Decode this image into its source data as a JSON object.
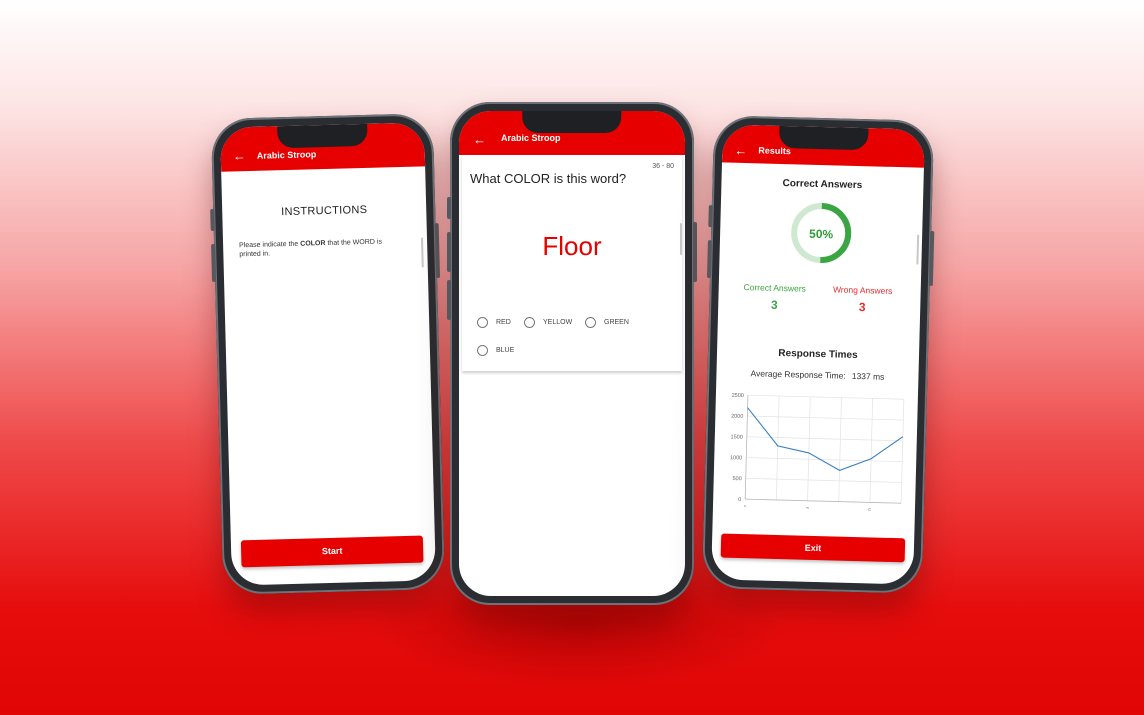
{
  "screens": {
    "instructions": {
      "title": "Arabic Stroop",
      "heading": "INSTRUCTIONS",
      "text_before": "Please indicate the ",
      "text_bold1": "COLOR",
      "text_mid": " that the ",
      "text_bold2": "WORD",
      "text_after": " is printed in.",
      "start_label": "Start"
    },
    "question": {
      "title": "Arabic Stroop",
      "counter": "36 - 80",
      "prompt": "What COLOR is this word?",
      "word": "Floor",
      "options": [
        "RED",
        "YELLOW",
        "GREEN",
        "BLUE"
      ]
    },
    "results": {
      "title": "Results",
      "correct_heading": "Correct Answers",
      "percent": "50%",
      "percent_value": 0.5,
      "correct_label": "Correct Answers",
      "correct_value": "3",
      "wrong_label": "Wrong Answers",
      "wrong_value": "3",
      "response_heading": "Response Times",
      "avg_label": "Average Response Time:",
      "avg_value": "1337 ms",
      "exit_label": "Exit"
    }
  },
  "colors": {
    "brand_red": "#e60000",
    "correct_green": "#3aa543",
    "wrong_red": "#ec2a2a",
    "line_blue": "#3a7fc2"
  },
  "chart_data": {
    "type": "line",
    "x": [
      1,
      2,
      3,
      4,
      5,
      6
    ],
    "y_ticks": [
      "2500",
      "2000",
      "1500",
      "1000",
      "500",
      "0"
    ],
    "x_ticks": [
      "1",
      "3",
      "5"
    ],
    "series": [
      {
        "values": [
          2200,
          1300,
          1150,
          750,
          1050,
          1600
        ]
      }
    ],
    "ylim": [
      0,
      2500
    ],
    "xlim": [
      1,
      6
    ],
    "grid": true
  }
}
